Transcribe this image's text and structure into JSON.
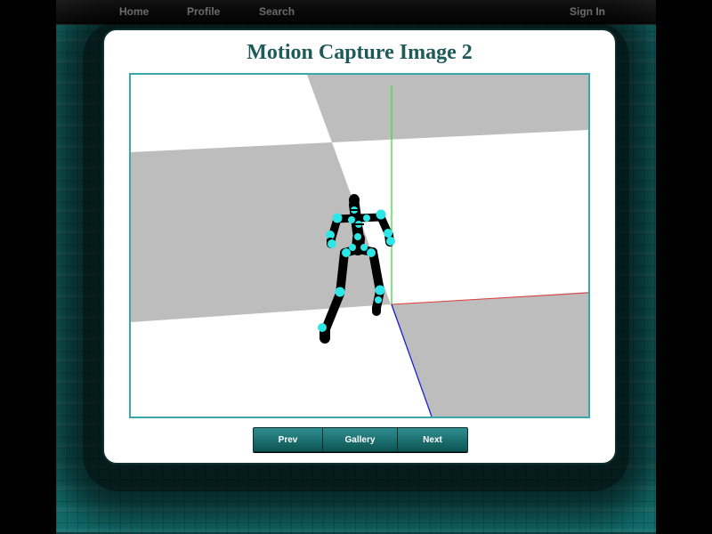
{
  "nav": {
    "home": "Home",
    "profile": "Profile",
    "search": "Search",
    "sign_in": "Sign In"
  },
  "page_title": "Motion Capture Image 2",
  "viewport": {
    "floor_colors": [
      "#ffffff",
      "#bdbdbd"
    ],
    "axis_colors": {
      "x": "#e23b3b",
      "y": "#3bdb3b",
      "z": "#2020d8"
    },
    "skeleton_color": "#000000",
    "joint_color": "#2fe6e6"
  },
  "pager": {
    "prev": "Prev",
    "gallery": "Gallery",
    "next": "Next"
  },
  "colors": {
    "title": "#1f5a5a",
    "accent": "#2e8e8e",
    "background": "#126f6e"
  }
}
